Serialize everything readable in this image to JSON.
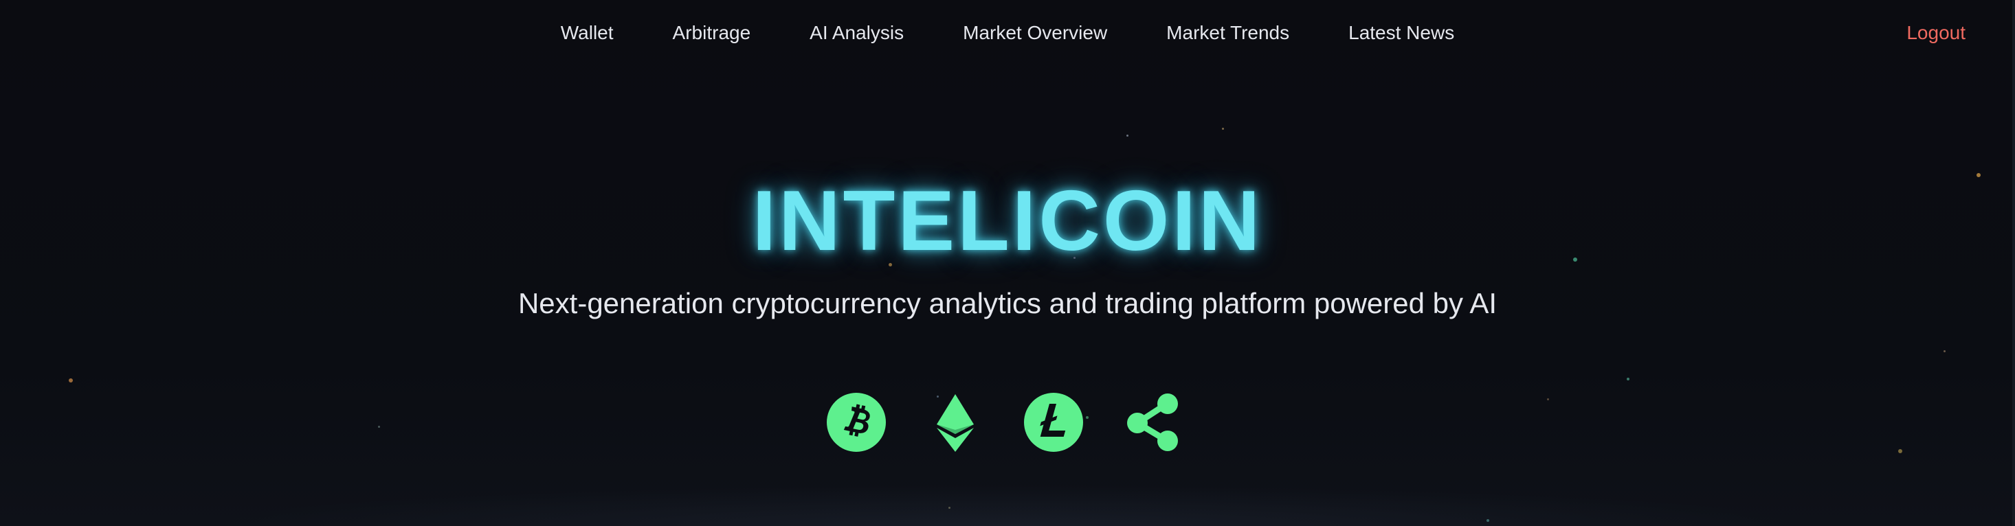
{
  "nav": {
    "links": [
      {
        "label": "Wallet"
      },
      {
        "label": "Arbitrage"
      },
      {
        "label": "AI Analysis"
      },
      {
        "label": "Market Overview"
      },
      {
        "label": "Market Trends"
      },
      {
        "label": "Latest News"
      }
    ],
    "logout_label": "Logout"
  },
  "hero": {
    "title": "INTELICOIN",
    "subtitle": "Next-generation cryptocurrency analytics and trading platform powered by AI"
  },
  "coins": [
    {
      "icon": "bitcoin-icon"
    },
    {
      "icon": "ethereum-icon"
    },
    {
      "icon": "litecoin-icon"
    },
    {
      "icon": "ripple-icon"
    }
  ],
  "colors": {
    "background": "#0b0d12",
    "accent_title": "#6fe6f2",
    "coin_green": "#5ef08e",
    "logout": "#f06a60",
    "text": "#e6e8ee"
  }
}
